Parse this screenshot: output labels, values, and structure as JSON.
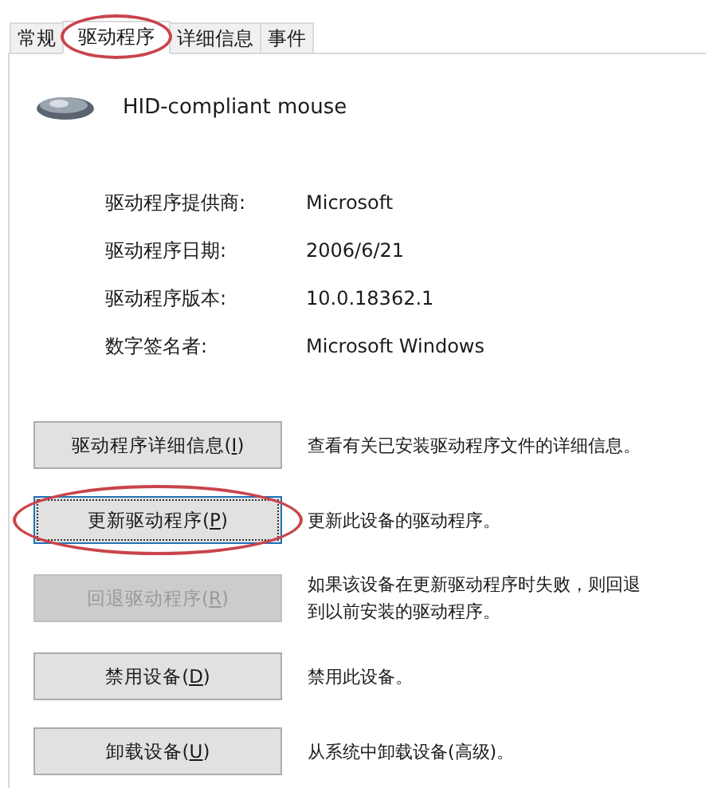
{
  "tabs": [
    {
      "label": "常规",
      "selected": false,
      "highlighted": false
    },
    {
      "label": "驱动程序",
      "selected": true,
      "highlighted": true
    },
    {
      "label": "详细信息",
      "selected": false,
      "highlighted": false
    },
    {
      "label": "事件",
      "selected": false,
      "highlighted": false
    }
  ],
  "device": {
    "name": "HID-compliant mouse"
  },
  "properties": [
    {
      "label": "驱动程序提供商:",
      "value": "Microsoft"
    },
    {
      "label": "驱动程序日期:",
      "value": "2006/6/21"
    },
    {
      "label": "驱动程序版本:",
      "value": "10.0.18362.1"
    },
    {
      "label": "数字签名者:",
      "value": "Microsoft Windows"
    }
  ],
  "actions": [
    {
      "button": "驱动程序详细信息(I)",
      "description": "查看有关已安装驱动程序文件的详细信息。",
      "disabled": false,
      "focused": false,
      "highlighted": false
    },
    {
      "button": "更新驱动程序(P)",
      "description": "更新此设备的驱动程序。",
      "disabled": false,
      "focused": true,
      "highlighted": true
    },
    {
      "button": "回退驱动程序(R)",
      "description": "如果该设备在更新驱动程序时失败，则回退到以前安装的驱动程序。",
      "disabled": true,
      "focused": false,
      "highlighted": false
    },
    {
      "button": "禁用设备(D)",
      "description": "禁用此设备。",
      "disabled": false,
      "focused": false,
      "highlighted": false
    },
    {
      "button": "卸载设备(U)",
      "description": "从系统中卸载设备(高级)。",
      "disabled": false,
      "focused": false,
      "highlighted": false
    }
  ]
}
